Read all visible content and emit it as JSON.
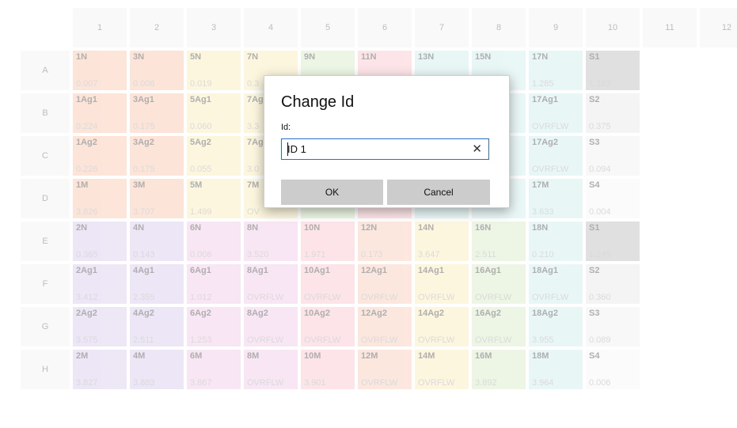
{
  "columns": [
    "1",
    "2",
    "3",
    "4",
    "5",
    "6",
    "7",
    "8",
    "9",
    "10",
    "11",
    "12"
  ],
  "rows": [
    {
      "label": "A",
      "cells": [
        {
          "id": "1N",
          "val": "0.007",
          "color": "#fbd0bc"
        },
        {
          "id": "3N",
          "val": "0.006",
          "color": "#fbd0bc"
        },
        {
          "id": "5N",
          "val": "0.019",
          "color": "#fbf0c4"
        },
        {
          "id": "7N",
          "val": "0.3",
          "color": "#fbf0c4"
        },
        {
          "id": "9N",
          "val": "",
          "color": "#dff0cf"
        },
        {
          "id": "11N",
          "val": "",
          "color": "#fbd0d6"
        },
        {
          "id": "13N",
          "val": "",
          "color": "#d7f1ef"
        },
        {
          "id": "15N",
          "val": "",
          "color": "#d7f1ef"
        },
        {
          "id": "17N",
          "val": "1.285",
          "color": "#d7f1ef"
        },
        {
          "id": "S1",
          "val": "1.183",
          "color": "#c7c7c7"
        },
        {
          "id": "",
          "val": "",
          "color": ""
        },
        {
          "id": "",
          "val": "",
          "color": ""
        }
      ]
    },
    {
      "label": "B",
      "cells": [
        {
          "id": "1Ag1",
          "val": "0.224",
          "color": "#fbd0bc"
        },
        {
          "id": "3Ag1",
          "val": "0.175",
          "color": "#fbd0bc"
        },
        {
          "id": "5Ag1",
          "val": "0.060",
          "color": "#fbf0c4"
        },
        {
          "id": "7Ag",
          "val": "3.3",
          "color": "#fbf0c4"
        },
        {
          "id": "",
          "val": "",
          "color": "#dff0cf"
        },
        {
          "id": "",
          "val": "",
          "color": "#fbd0d6"
        },
        {
          "id": "",
          "val": "",
          "color": "#d7f1ef"
        },
        {
          "id": "",
          "val": "",
          "color": "#d7f1ef"
        },
        {
          "id": "17Ag1",
          "val": "OVRFLW",
          "color": "#d7f1ef"
        },
        {
          "id": "S2",
          "val": "0.375",
          "color": "#ededed"
        },
        {
          "id": "",
          "val": "",
          "color": ""
        },
        {
          "id": "",
          "val": "",
          "color": ""
        }
      ]
    },
    {
      "label": "C",
      "cells": [
        {
          "id": "1Ag2",
          "val": "0.226",
          "color": "#fbd0bc"
        },
        {
          "id": "3Ag2",
          "val": "0.175",
          "color": "#fbd0bc"
        },
        {
          "id": "5Ag2",
          "val": "0.055",
          "color": "#fbf0c4"
        },
        {
          "id": "7Ag",
          "val": "3.0",
          "color": "#fbf0c4"
        },
        {
          "id": "",
          "val": "",
          "color": "#dff0cf"
        },
        {
          "id": "",
          "val": "",
          "color": "#fbd0d6"
        },
        {
          "id": "",
          "val": "",
          "color": "#d7f1ef"
        },
        {
          "id": "",
          "val": "",
          "color": "#d7f1ef"
        },
        {
          "id": "17Ag2",
          "val": "OVRFLW",
          "color": "#d7f1ef"
        },
        {
          "id": "S3",
          "val": "0.094",
          "color": "#f4f4f4"
        },
        {
          "id": "",
          "val": "",
          "color": ""
        },
        {
          "id": "",
          "val": "",
          "color": ""
        }
      ]
    },
    {
      "label": "D",
      "cells": [
        {
          "id": "1M",
          "val": "3.826",
          "color": "#fbd0bc"
        },
        {
          "id": "3M",
          "val": "3.707",
          "color": "#fbd0bc"
        },
        {
          "id": "5M",
          "val": "1.499",
          "color": "#fbf0c4"
        },
        {
          "id": "7M",
          "val": "OV",
          "color": "#fbf0c4"
        },
        {
          "id": "",
          "val": "",
          "color": "#dff0cf"
        },
        {
          "id": "",
          "val": "",
          "color": "#fbd0d6"
        },
        {
          "id": "",
          "val": "",
          "color": "#d7f1ef"
        },
        {
          "id": "",
          "val": "",
          "color": "#d7f1ef"
        },
        {
          "id": "17M",
          "val": "3.633",
          "color": "#d7f1ef"
        },
        {
          "id": "S4",
          "val": "0.004",
          "color": "#f8f8f8"
        },
        {
          "id": "",
          "val": "",
          "color": ""
        },
        {
          "id": "",
          "val": "",
          "color": ""
        }
      ]
    },
    {
      "label": "E",
      "cells": [
        {
          "id": "2N",
          "val": "0.365",
          "color": "#ded3f0"
        },
        {
          "id": "4N",
          "val": "0.143",
          "color": "#ded3f0"
        },
        {
          "id": "6N",
          "val": "0.006",
          "color": "#f5d3ec"
        },
        {
          "id": "8N",
          "val": "3.520",
          "color": "#f5d3ec"
        },
        {
          "id": "10N",
          "val": "1.971",
          "color": "#fbd0d6"
        },
        {
          "id": "12N",
          "val": "0.173",
          "color": "#fbd4c6"
        },
        {
          "id": "14N",
          "val": "3.647",
          "color": "#fbf0c4"
        },
        {
          "id": "16N",
          "val": "2.511",
          "color": "#dff0cf"
        },
        {
          "id": "18N",
          "val": "0.210",
          "color": "#d7f1ef"
        },
        {
          "id": "S1",
          "val": "1.245",
          "color": "#c7c7c7"
        },
        {
          "id": "",
          "val": "",
          "color": ""
        },
        {
          "id": "",
          "val": "",
          "color": ""
        }
      ]
    },
    {
      "label": "F",
      "cells": [
        {
          "id": "2Ag1",
          "val": "3.412",
          "color": "#ded3f0"
        },
        {
          "id": "4Ag1",
          "val": "2.355",
          "color": "#ded3f0"
        },
        {
          "id": "6Ag1",
          "val": "1.012",
          "color": "#f5d3ec"
        },
        {
          "id": "8Ag1",
          "val": "OVRFLW",
          "color": "#f5d3ec"
        },
        {
          "id": "10Ag1",
          "val": "OVRFLW",
          "color": "#fbd0d6"
        },
        {
          "id": "12Ag1",
          "val": "OVRFLW",
          "color": "#fbd4c6"
        },
        {
          "id": "14Ag1",
          "val": "OVRFLW",
          "color": "#fbf0c4"
        },
        {
          "id": "16Ag1",
          "val": "OVRFLW",
          "color": "#dff0cf"
        },
        {
          "id": "18Ag1",
          "val": "OVRFLW",
          "color": "#d7f1ef"
        },
        {
          "id": "S2",
          "val": "0.360",
          "color": "#ededed"
        },
        {
          "id": "",
          "val": "",
          "color": ""
        },
        {
          "id": "",
          "val": "",
          "color": ""
        }
      ]
    },
    {
      "label": "G",
      "cells": [
        {
          "id": "2Ag2",
          "val": "3.575",
          "color": "#ded3f0"
        },
        {
          "id": "4Ag2",
          "val": "2.511",
          "color": "#ded3f0"
        },
        {
          "id": "6Ag2",
          "val": "1.253",
          "color": "#f5d3ec"
        },
        {
          "id": "8Ag2",
          "val": "OVRFLW",
          "color": "#f5d3ec"
        },
        {
          "id": "10Ag2",
          "val": "OVRFLW",
          "color": "#fbd0d6"
        },
        {
          "id": "12Ag2",
          "val": "OVRFLW",
          "color": "#fbd4c6"
        },
        {
          "id": "14Ag2",
          "val": "OVRFLW",
          "color": "#fbf0c4"
        },
        {
          "id": "16Ag2",
          "val": "OVRFLW",
          "color": "#dff0cf"
        },
        {
          "id": "18Ag2",
          "val": "3.955",
          "color": "#d7f1ef"
        },
        {
          "id": "S3",
          "val": "0.089",
          "color": "#f4f4f4"
        },
        {
          "id": "",
          "val": "",
          "color": ""
        },
        {
          "id": "",
          "val": "",
          "color": ""
        }
      ]
    },
    {
      "label": "H",
      "cells": [
        {
          "id": "2M",
          "val": "3.827",
          "color": "#ded3f0"
        },
        {
          "id": "4M",
          "val": "3.883",
          "color": "#ded3f0"
        },
        {
          "id": "6M",
          "val": "3.867",
          "color": "#f5d3ec"
        },
        {
          "id": "8M",
          "val": "OVRFLW",
          "color": "#f5d3ec"
        },
        {
          "id": "10M",
          "val": "3.901",
          "color": "#fbd0d6"
        },
        {
          "id": "12M",
          "val": "OVRFLW",
          "color": "#fbd4c6"
        },
        {
          "id": "14M",
          "val": "OVRFLW",
          "color": "#fbf0c4"
        },
        {
          "id": "16M",
          "val": "3.892",
          "color": "#dff0cf"
        },
        {
          "id": "18M",
          "val": "3.964",
          "color": "#d7f1ef"
        },
        {
          "id": "S4",
          "val": "0.006",
          "color": "#f8f8f8"
        },
        {
          "id": "",
          "val": "",
          "color": ""
        },
        {
          "id": "",
          "val": "",
          "color": ""
        }
      ]
    }
  ],
  "dialog": {
    "title": "Change Id",
    "field_label": "Id:",
    "field_value": "ID 1",
    "clear_glyph": "✕",
    "ok_label": "OK",
    "cancel_label": "Cancel"
  }
}
